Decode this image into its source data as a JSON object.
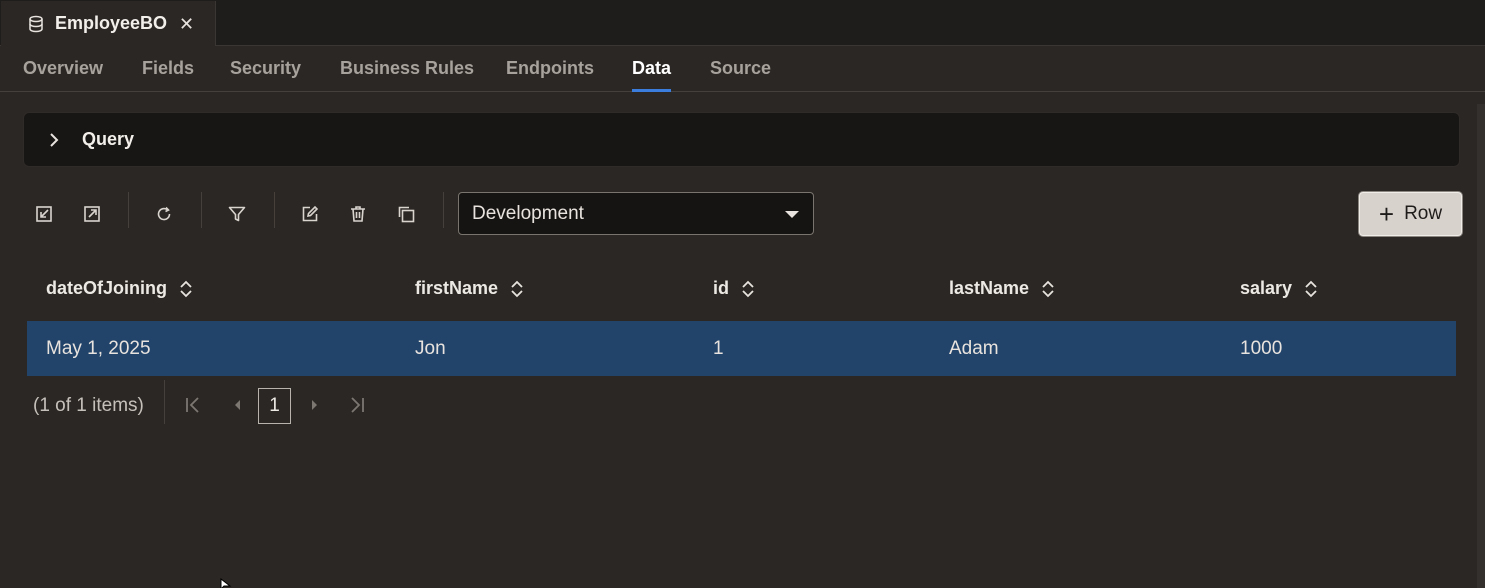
{
  "document_tab": {
    "title": "EmployeeBO",
    "close_symbol": "✕",
    "icon": "database-icon"
  },
  "sub_tabs": [
    {
      "label": "Overview",
      "active": false
    },
    {
      "label": "Fields",
      "active": false
    },
    {
      "label": "Security",
      "active": false
    },
    {
      "label": "Business Rules",
      "active": false
    },
    {
      "label": "Endpoints",
      "active": false
    },
    {
      "label": "Data",
      "active": true
    },
    {
      "label": "Source",
      "active": false
    }
  ],
  "query": {
    "label": "Query"
  },
  "toolbar": {
    "icons": [
      "import-icon",
      "export-icon",
      "refresh-icon",
      "filter-icon",
      "edit-icon",
      "delete-icon",
      "duplicate-icon"
    ],
    "environment": {
      "selected": "Development"
    },
    "add_row": {
      "label": "Row",
      "symbol": "+"
    }
  },
  "grid": {
    "columns": [
      "dateOfJoining",
      "firstName",
      "id",
      "lastName",
      "salary"
    ],
    "rows": [
      [
        "May 1, 2025",
        "Jon",
        "1",
        "Adam",
        "1000"
      ]
    ],
    "selected_row_color": "#22446a"
  },
  "pagination": {
    "summary": "(1 of 1 items)",
    "current_page": "1"
  },
  "colors": {
    "accent": "#3b7ddd",
    "background": "#2b2724"
  }
}
